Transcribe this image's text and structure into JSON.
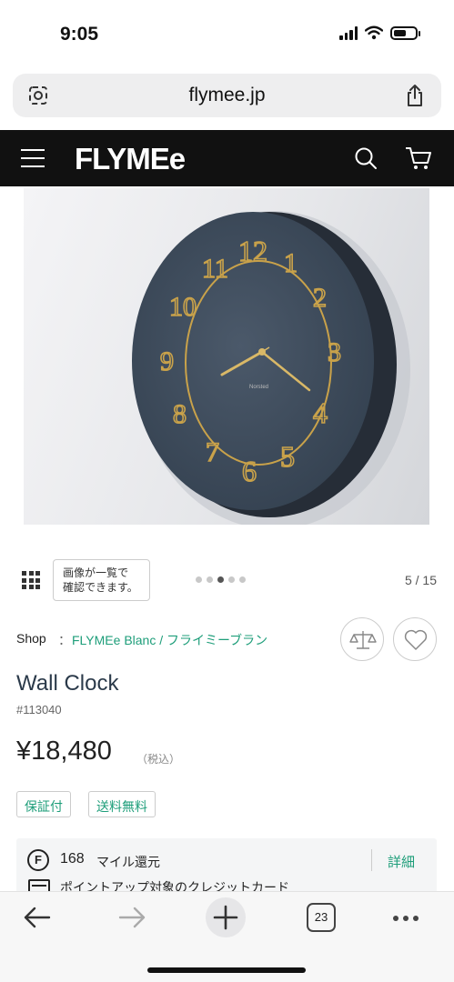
{
  "status_bar": {
    "time": "9:05",
    "battery_level": 0.6
  },
  "browser": {
    "url": "flymee.jp",
    "open_tabs": "23"
  },
  "site_header": {
    "logo": "FLYMEe"
  },
  "hero": {
    "clock_brand": "Norsted",
    "numerals": [
      "12",
      "1",
      "2",
      "3",
      "4",
      "5",
      "6",
      "7",
      "8",
      "9",
      "10",
      "11"
    ]
  },
  "gallery": {
    "tip_line1": "画像が一覧で",
    "tip_line2": "確認できます。",
    "dot_count": 5,
    "active_dot": 3,
    "counter": "5 / 15"
  },
  "product": {
    "shop_label": "Shop",
    "shop_separator": "：",
    "shop_link": "FLYMEe Blanc / フライミーブラン",
    "title": "Wall Clock",
    "code": "#113040",
    "price": "¥18,480",
    "tax_note": "（税込）",
    "tags": [
      "保証付",
      "送料無料"
    ]
  },
  "miles": {
    "icon_letter": "F",
    "count": "168",
    "text": "マイル還元",
    "detail_link": "詳細",
    "card_text": "ポイントアップ対象のクレジットカード"
  },
  "colors": {
    "accent": "#1e9e7a",
    "header_bg": "#111111",
    "clock_face": "#3f4d5e",
    "gold": "#c9a24a"
  }
}
